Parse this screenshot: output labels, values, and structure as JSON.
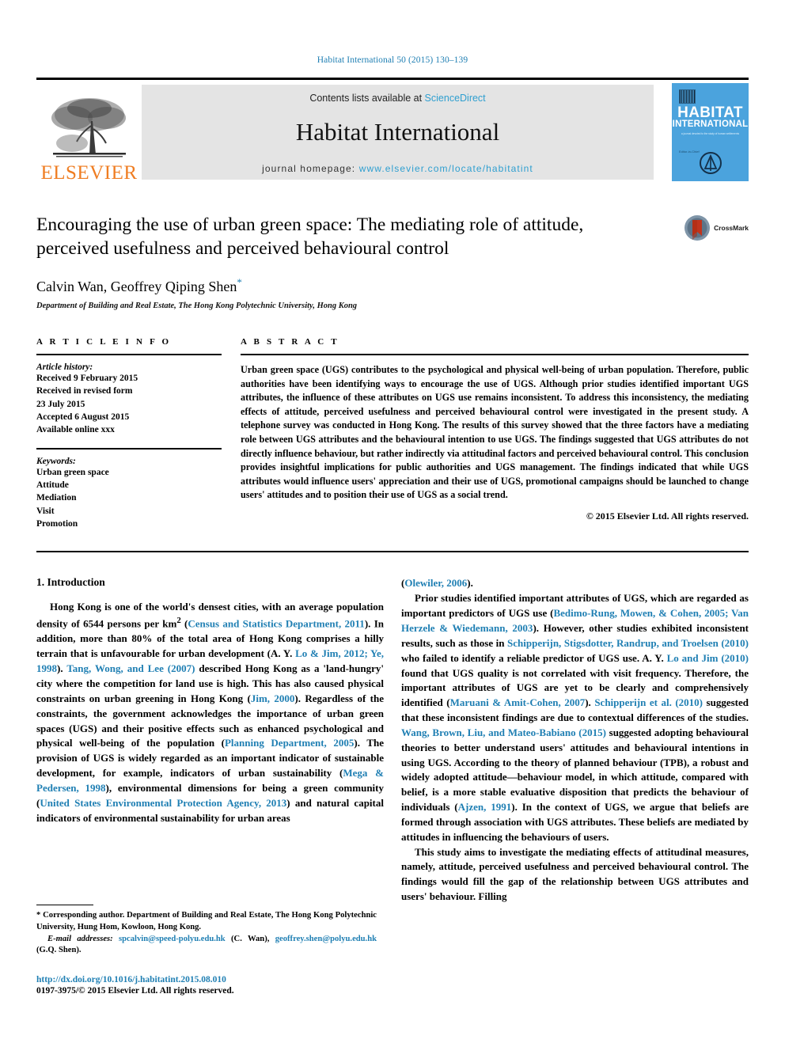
{
  "running_head": "Habitat International 50 (2015) 130–139",
  "masthead": {
    "publisher_name": "ELSEVIER",
    "contents_prefix": "Contents lists available at ",
    "sciencedirect": "ScienceDirect",
    "journal_name": "Habitat International",
    "homepage_label": "journal homepage: ",
    "homepage_url": "www.elsevier.com/locate/habitatint",
    "cover": {
      "line1": "HABITAT",
      "line2": "INTERNATIONAL",
      "subtitle": "a journal devoted to the study of human settlements",
      "side_note": "Editor-in-Chief"
    }
  },
  "title_block": {
    "title": "Encouraging the use of urban green space: The mediating role of attitude, perceived usefulness and perceived behavioural control",
    "authors": "Calvin Wan, Geoffrey Qiping Shen",
    "corresponding_marker": "*",
    "affiliation": "Department of Building and Real Estate, The Hong Kong Polytechnic University, Hong Kong",
    "crossmark_label": "CrossMark"
  },
  "article_info": {
    "heading": "A R T I C L E  I N F O",
    "history_label": "Article history:",
    "history": [
      "Received 9 February 2015",
      "Received in revised form",
      "23 July 2015",
      "Accepted 6 August 2015",
      "Available online xxx"
    ],
    "keywords_label": "Keywords:",
    "keywords": [
      "Urban green space",
      "Attitude",
      "Mediation",
      "Visit",
      "Promotion"
    ]
  },
  "abstract": {
    "heading": "A B S T R A C T",
    "text": "Urban green space (UGS) contributes to the psychological and physical well-being of urban population. Therefore, public authorities have been identifying ways to encourage the use of UGS. Although prior studies identified important UGS attributes, the influence of these attributes on UGS use remains inconsistent. To address this inconsistency, the mediating effects of attitude, perceived usefulness and perceived behavioural control were investigated in the present study. A telephone survey was conducted in Hong Kong. The results of this survey showed that the three factors have a mediating role between UGS attributes and the behavioural intention to use UGS. The findings suggested that UGS attributes do not directly influence behaviour, but rather indirectly via attitudinal factors and perceived behavioural control. This conclusion provides insightful implications for public authorities and UGS management. The findings indicated that while UGS attributes would influence users' appreciation and their use of UGS, promotional campaigns should be launched to change users' attitudes and to position their use of UGS as a social trend.",
    "copyright": "© 2015 Elsevier Ltd. All rights reserved."
  },
  "body": {
    "section_number_title": "1. Introduction",
    "left_paragraph_1_segments": [
      {
        "t": "Hong Kong is one of the world's densest cities, with an average population density of 6544 persons per km",
        "k": "plain"
      },
      {
        "t": "2",
        "k": "sup"
      },
      {
        "t": " (",
        "k": "plain"
      },
      {
        "t": "Census and Statistics Department, 2011",
        "k": "ref"
      },
      {
        "t": "). In addition, more than 80% of the total area of Hong Kong comprises a hilly terrain that is unfavourable for urban development (A. Y. ",
        "k": "plain"
      },
      {
        "t": "Lo & Jim, 2012; Ye, 1998",
        "k": "ref"
      },
      {
        "t": "). ",
        "k": "plain"
      },
      {
        "t": "Tang, Wong, and Lee (2007)",
        "k": "ref"
      },
      {
        "t": " described Hong Kong as a 'land-hungry' city where the competition for land use is high. This has also caused physical constraints on urban greening in Hong Kong (",
        "k": "plain"
      },
      {
        "t": "Jim, 2000",
        "k": "ref"
      },
      {
        "t": "). Regardless of the constraints, the government acknowledges the importance of urban green spaces (UGS) and their positive effects such as enhanced psychological and physical well-being of the population (",
        "k": "plain"
      },
      {
        "t": "Planning Department, 2005",
        "k": "ref"
      },
      {
        "t": "). The provision of UGS is widely regarded as an important indicator of sustainable development, for example, indicators of urban sustainability (",
        "k": "plain"
      },
      {
        "t": "Mega & Pedersen, 1998",
        "k": "ref"
      },
      {
        "t": "), environmental dimensions for being a green community (",
        "k": "plain"
      },
      {
        "t": "United States Environmental Protection Agency, 2013",
        "k": "ref"
      },
      {
        "t": ") and natural capital indicators of environmental sustainability for urban areas",
        "k": "plain"
      }
    ],
    "right_continuation_segments": [
      {
        "t": "(",
        "k": "plain"
      },
      {
        "t": "Olewiler, 2006",
        "k": "ref"
      },
      {
        "t": ").",
        "k": "plain"
      }
    ],
    "right_paragraph_1_segments": [
      {
        "t": "Prior studies identified important attributes of UGS, which are regarded as important predictors of UGS use (",
        "k": "plain"
      },
      {
        "t": "Bedimo-Rung, Mowen, & Cohen, 2005; Van Herzele & Wiedemann, 2003",
        "k": "ref"
      },
      {
        "t": "). However, other studies exhibited inconsistent results, such as those in ",
        "k": "plain"
      },
      {
        "t": "Schipperijn, Stigsdotter, Randrup, and Troelsen (2010)",
        "k": "ref"
      },
      {
        "t": " who failed to identify a reliable predictor of UGS use. A. Y. ",
        "k": "plain"
      },
      {
        "t": "Lo and Jim (2010)",
        "k": "ref"
      },
      {
        "t": " found that UGS quality is not correlated with visit frequency. Therefore, the important attributes of UGS are yet to be clearly and comprehensively identified (",
        "k": "plain"
      },
      {
        "t": "Maruani & Amit-Cohen, 2007",
        "k": "ref"
      },
      {
        "t": "). ",
        "k": "plain"
      },
      {
        "t": "Schipperijn et al. (2010)",
        "k": "ref"
      },
      {
        "t": " suggested that these inconsistent findings are due to contextual differences of the studies. ",
        "k": "plain"
      },
      {
        "t": "Wang, Brown, Liu, and Mateo-Babiano (2015)",
        "k": "ref"
      },
      {
        "t": " suggested adopting behavioural theories to better understand users' attitudes and behavioural intentions in using UGS. According to the theory of planned behaviour (TPB), a robust and widely adopted attitude—behaviour model, in which attitude, compared with belief, is a more stable evaluative disposition that predicts the behaviour of individuals (",
        "k": "plain"
      },
      {
        "t": "Ajzen, 1991",
        "k": "ref"
      },
      {
        "t": "). In the context of UGS, we argue that beliefs are formed through association with UGS attributes. These beliefs are mediated by attitudes in influencing the behaviours of users.",
        "k": "plain"
      }
    ],
    "right_paragraph_2_segments": [
      {
        "t": "This study aims to investigate the mediating effects of attitudinal measures, namely, attitude, perceived usefulness and perceived behavioural control. The findings would fill the gap of the relationship between UGS attributes and users' behaviour. Filling",
        "k": "plain"
      }
    ]
  },
  "footnotes": {
    "corresponding_marker": "*",
    "corresponding_text": " Corresponding author. Department of Building and Real Estate, The Hong Kong Polytechnic University, Hung Hom, Kowloon, Hong Kong.",
    "email_label": "E-mail addresses:",
    "email_1": "spcalvin@speed-polyu.edu.hk",
    "email_1_owner": " (C. Wan), ",
    "email_2": "geoffrey.shen@polyu.edu.hk",
    "email_2_owner": " (G.Q. Shen).",
    "doi": "http://dx.doi.org/10.1016/j.habitatint.2015.08.010",
    "issn_line": "0197-3975/© 2015 Elsevier Ltd. All rights reserved."
  },
  "colors": {
    "link_blue": "#1f7fb3",
    "sciencedirect_blue": "#2f9fd0",
    "elsevier_orange": "#ef7d22",
    "cover_blue": "#4ba3dd",
    "banner_grey": "#e4e4e4"
  }
}
